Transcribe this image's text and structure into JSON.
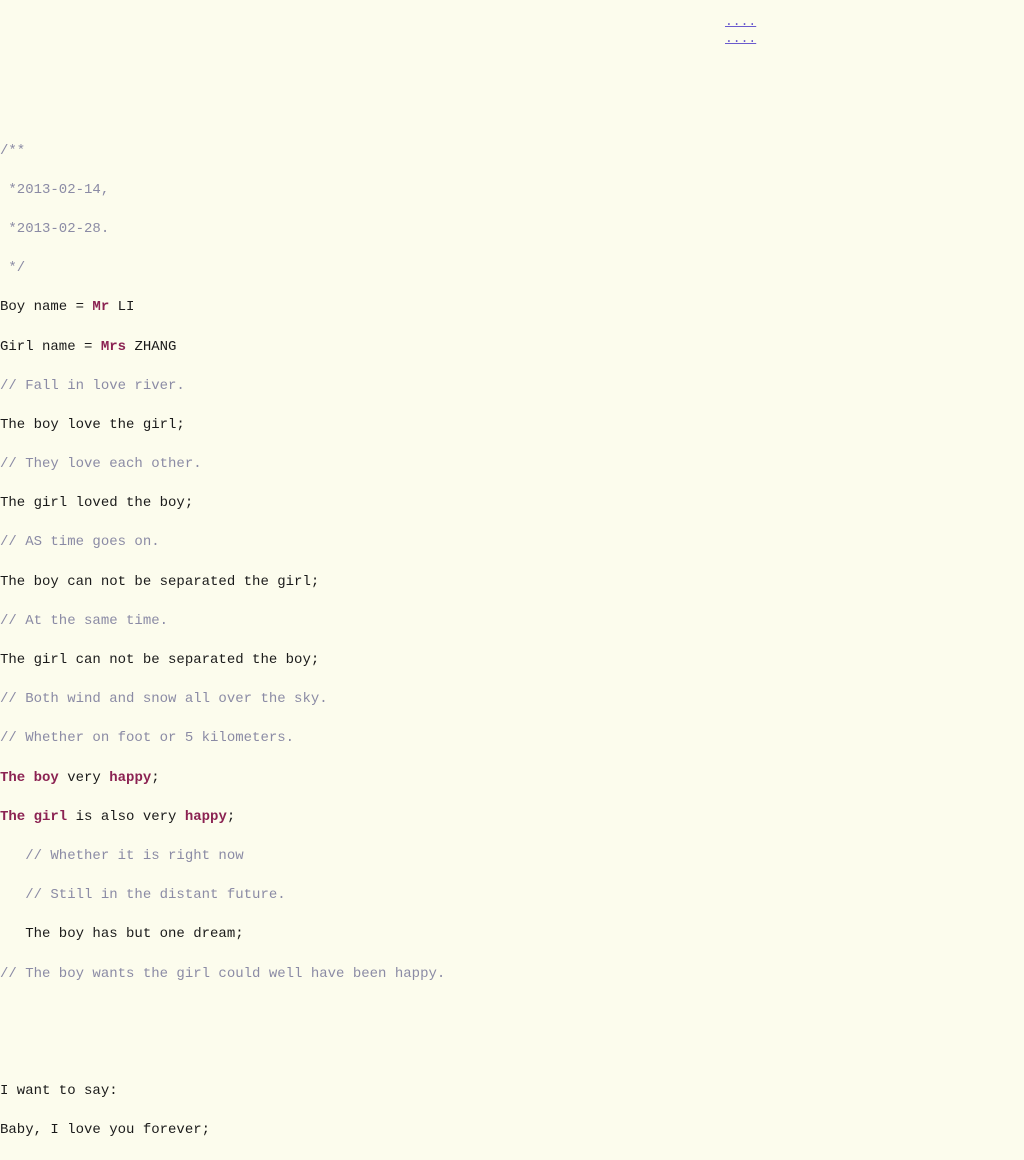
{
  "dots": {
    "line1": "....",
    "line2": "...."
  },
  "doc_comment": {
    "open": "/**",
    "l1": " *2013-02-14,",
    "l2": " *2013-02-28.",
    "close": " */"
  },
  "boy_name": {
    "pre": "Boy name = ",
    "title": "Mr",
    "rest": " LI"
  },
  "girl_name": {
    "pre": "Girl name = ",
    "title": "Mrs",
    "rest": " ZHANG"
  },
  "c1": "// Fall in love river.",
  "l1": "The boy love the girl;",
  "c2": "// They love each other.",
  "l2": "The girl loved the boy;",
  "c3": "// AS time goes on.",
  "l3": "The boy can not be separated the girl;",
  "c4": "// At the same time.",
  "l4": "The girl can not be separated the boy;",
  "c5": "// Both wind and snow all over the sky.",
  "c6": "// Whether on foot or 5 kilometers.",
  "happy1": {
    "a": "The boy",
    "b": " very ",
    "c": "happy",
    "d": ";"
  },
  "happy2": {
    "a": "The girl",
    "b": " is also very ",
    "c": "happy",
    "d": ";"
  },
  "c7": "   // Whether it is right now",
  "c8": "   // Still in the distant future.",
  "l5": "   The boy has but one dream;",
  "c9": "// The boy wants the girl could well have been happy.",
  "say1": "I want to say:",
  "say2": "Baby, I love you forever;"
}
